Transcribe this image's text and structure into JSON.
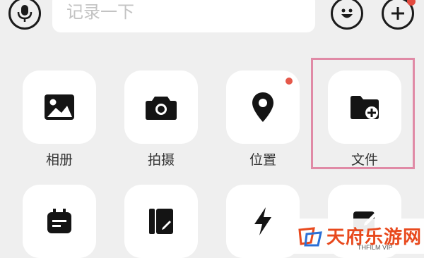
{
  "input": {
    "placeholder": "记录一下"
  },
  "icons": {
    "voice": "microphone-icon",
    "emoji": "smiley-icon",
    "add": "plus-icon"
  },
  "tiles_row1": [
    {
      "label": "相册",
      "icon": "image-icon"
    },
    {
      "label": "拍摄",
      "icon": "camera-icon"
    },
    {
      "label": "位置",
      "icon": "location-pin-icon",
      "badge": true
    },
    {
      "label": "文件",
      "icon": "folder-plus-icon",
      "highlighted": true
    }
  ],
  "tiles_row2": [
    {
      "icon": "calendar-icon"
    },
    {
      "icon": "notebook-pen-icon"
    },
    {
      "icon": "lightning-icon"
    },
    {
      "icon": "edit-square-icon"
    }
  ],
  "colors": {
    "badge": "#e5584a",
    "highlight_border": "#e08aa6"
  },
  "watermark": {
    "title": "天府乐游网",
    "subtitle": "THFILM VIP"
  }
}
